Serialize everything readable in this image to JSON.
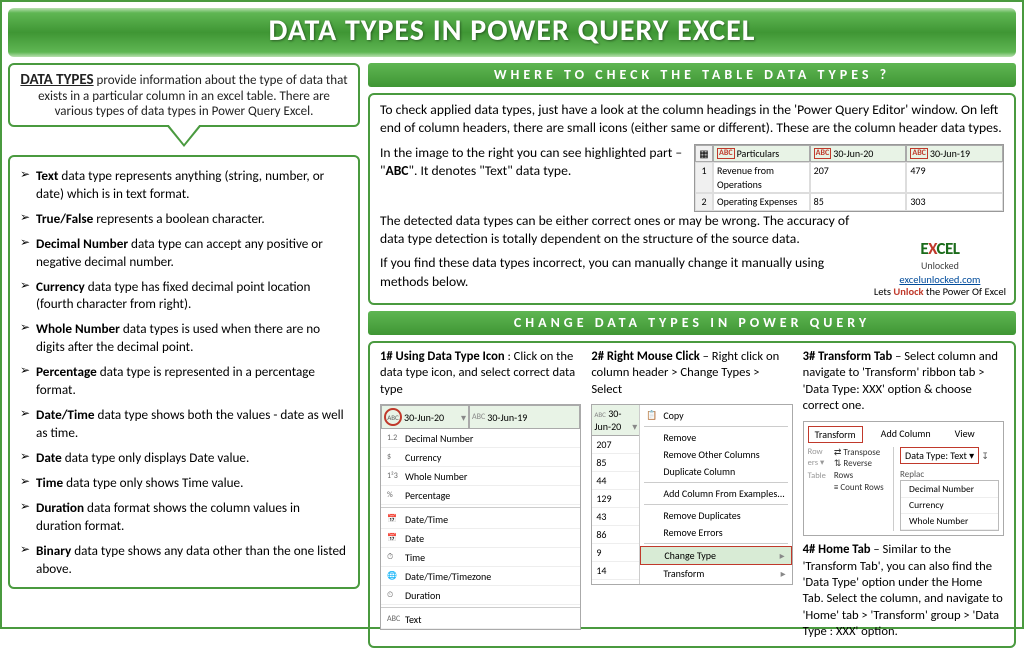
{
  "banner": "DATA TYPES IN POWER QUERY EXCEL",
  "intro": {
    "lead": "DATA TYPES",
    "rest": " provide information about the type of data that exists in a particular column in an excel table. There are various types of data types in Power Query Excel."
  },
  "datatypes": [
    {
      "b": "Text",
      "t": " data type represents anything (string, number, or date) which is in text format."
    },
    {
      "b": "True/False",
      "t": " represents a boolean character."
    },
    {
      "b": "Decimal Number",
      "t": " data type can accept any positive or negative decimal number."
    },
    {
      "b": "Currency",
      "t": " data type has fixed decimal point location (fourth character from right)."
    },
    {
      "b": "Whole Number",
      "t": " data types is used when there are no digits after the decimal point."
    },
    {
      "b": "Percentage",
      "t": " data type is represented in a percentage format."
    },
    {
      "b": "Date/Time",
      "t": " data type shows both the values - date as well as time."
    },
    {
      "b": "Date",
      "t": " data type only displays Date value."
    },
    {
      "b": "Time",
      "t": " data type only shows Time value."
    },
    {
      "b": "Duration",
      "t": " data format shows the column values in duration format."
    },
    {
      "b": "Binary",
      "t": " data type shows any data other than the one listed above."
    }
  ],
  "section1": {
    "head": "WHERE TO CHECK THE TABLE DATA TYPES ?",
    "p1": "To check applied data types, just have a look at the column headings in the 'Power Query Editor' window. On left end of column headers, there are small icons (either same or different). These are the column header data types.",
    "p2a": "In the image to the right you can see highlighted part – \"",
    "p2b": "ABC",
    "p2c": "\". It denotes \"Text\" data type.",
    "p3": "The detected data types can be either correct ones or may be wrong. The accuracy of data type detection is totally dependent on the structure of the source data.",
    "p4": "If you find these data types incorrect, you can manually change it manually using methods below.",
    "table": {
      "headers": [
        "",
        "Particulars",
        "30-Jun-20",
        "30-Jun-19"
      ],
      "rows": [
        [
          "1",
          "Revenue from Operations",
          "207",
          "479"
        ],
        [
          "2",
          "Operating Expenses",
          "85",
          "303"
        ]
      ]
    },
    "logo": {
      "brand1": "E",
      "brandX": "X",
      "brand2": "CEL",
      "sub": "Unlocked",
      "url": "excelunlocked.com",
      "tag1": "Lets ",
      "tagR": "Unlock",
      "tag2": " the Power Of Excel"
    }
  },
  "section2": {
    "head": "CHANGE DATA TYPES IN POWER QUERY",
    "m1": {
      "ttl": "1# Using Data Type Icon",
      "txt": " : Click on the data type icon, and select correct data type",
      "hdr": [
        "30-Jun-20",
        "30-Jun-19"
      ],
      "opts": [
        "Decimal Number",
        "Currency",
        "Whole Number",
        "Percentage",
        "Date/Time",
        "Date",
        "Time",
        "Date/Time/Timezone",
        "Duration",
        "Text"
      ]
    },
    "m2": {
      "ttl": "2# Right Mouse Click",
      "txt": " – Right click on column header > Change Types > Select",
      "hdr": "30-Jun-20",
      "vals": [
        "207",
        "85",
        "44",
        "129",
        "43",
        "86",
        "9",
        "14"
      ],
      "menu": [
        "Copy",
        "Remove",
        "Remove Other Columns",
        "Duplicate Column",
        "Add Column From Examples...",
        "Remove Duplicates",
        "Remove Errors",
        "Change Type",
        "Transform"
      ]
    },
    "m3": {
      "ttl": "3# Transform Tab",
      "txt": " – Select column and navigate to 'Transform' ribbon tab > 'Data Type: XXX' option & choose correct one.",
      "tabs": [
        "Transform",
        "Add Column",
        "View"
      ],
      "left": [
        "⇄ Transpose",
        "⇅ Reverse Rows",
        "≡ Count Rows"
      ],
      "leftFoot": "Table",
      "dt": "Data Type: Text ▾",
      "repl": "↧ Replac",
      "dd": [
        "Decimal Number",
        "Currency",
        "Whole Number"
      ]
    },
    "m4": {
      "ttl": "4# Home Tab",
      "txt": " – Similar to the 'Transform Tab', you can also find the 'Data Type' option under the Home Tab. Select the column, and navigate to 'Home' tab > 'Transform' group > 'Data Type : XXX' option."
    }
  }
}
